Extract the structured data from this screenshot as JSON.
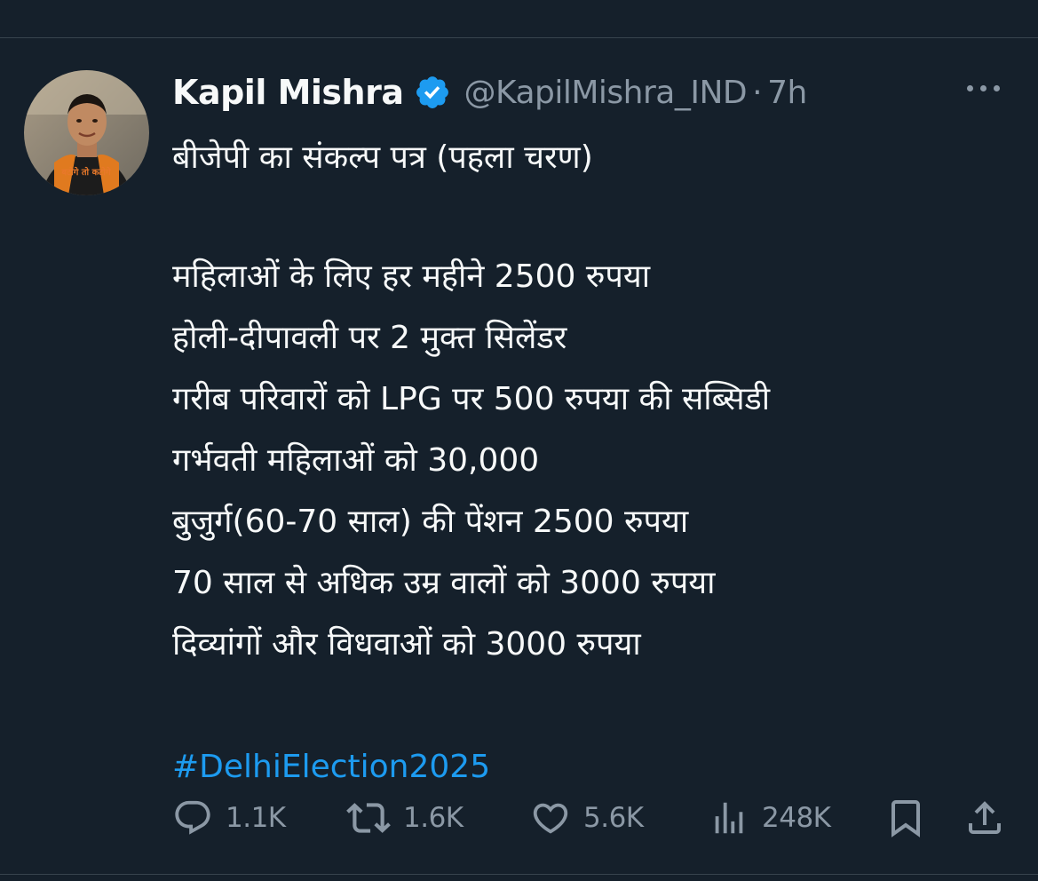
{
  "author": {
    "display_name": "Kapil Mishra",
    "handle": "@KapilMishra_IND",
    "separator": "·",
    "time": "7h",
    "avatar_shirt_text": "बटोगे तो कटोगे"
  },
  "tweet": {
    "title": "बीजेपी का संकल्प पत्र (पहला चरण)",
    "lines": [
      "महिलाओं के लिए हर महीने 2500 रुपया",
      "होली-दीपावली पर 2 मुक्त सिलेंडर",
      "गरीब परिवारों को LPG पर 500 रुपया की सब्सिडी",
      "गर्भवती महिलाओं को 30,000",
      "बुजुर्ग(60-70 साल) की पेंशन 2500 रुपया",
      "70 साल से अधिक उम्र वालों को 3000 रुपया",
      "दिव्यांगों और विधवाओं को 3000 रुपया"
    ],
    "hashtag": "#DelhiElection2025"
  },
  "actions": {
    "replies": "1.1K",
    "reposts": "1.6K",
    "likes": "5.6K",
    "views": "248K"
  },
  "icons": {
    "verified": "verified-badge-icon",
    "more": "more-icon",
    "reply": "reply-icon",
    "repost": "repost-icon",
    "like": "like-icon",
    "views": "views-icon",
    "bookmark": "bookmark-icon",
    "share": "share-icon"
  },
  "colors": {
    "background": "#15202b",
    "text": "#f7f9f9",
    "secondary": "#8b98a5",
    "accent": "#1d9bf0",
    "divider": "#38444d"
  }
}
